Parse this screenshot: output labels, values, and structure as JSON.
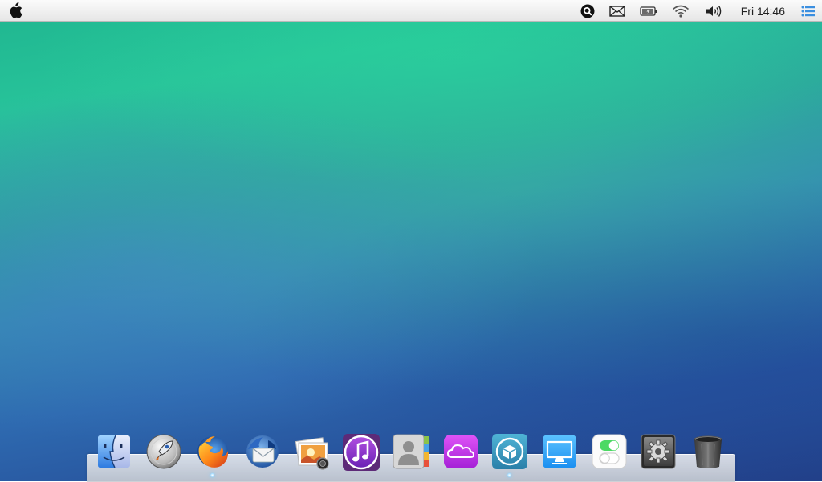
{
  "menubar": {
    "apple_icon": "apple-logo-icon",
    "status_icons": [
      "search-icon",
      "mail-icon",
      "battery-icon",
      "wifi-icon",
      "volume-icon",
      "menu-list-icon"
    ],
    "clock": "Fri 14:46"
  },
  "dock": {
    "items": [
      {
        "name": "finder",
        "icon": "finder-icon",
        "running": false
      },
      {
        "name": "launchpad",
        "icon": "rocket-icon",
        "running": false
      },
      {
        "name": "firefox",
        "icon": "firefox-icon",
        "running": true
      },
      {
        "name": "thunderbird",
        "icon": "thunderbird-icon",
        "running": false
      },
      {
        "name": "photos",
        "icon": "photos-icon",
        "running": false
      },
      {
        "name": "itunes",
        "icon": "music-note-icon",
        "running": false
      },
      {
        "name": "contacts",
        "icon": "contacts-icon",
        "running": false
      },
      {
        "name": "icloud",
        "icon": "cloud-icon",
        "running": false
      },
      {
        "name": "app-store",
        "icon": "package-icon",
        "running": true
      },
      {
        "name": "display",
        "icon": "monitor-icon",
        "running": false
      },
      {
        "name": "toggles",
        "icon": "toggle-icon",
        "running": false
      },
      {
        "name": "system-preferences",
        "icon": "gear-icon",
        "running": false
      },
      {
        "name": "trash",
        "icon": "trash-icon",
        "running": false
      }
    ]
  },
  "colors": {
    "accent": "#2ab99a",
    "menubar_bg": "#f2f2f2",
    "itunes": "#8e3ccf",
    "icloud": "#c63ae8",
    "running_indicator": "#6fc8ff"
  }
}
